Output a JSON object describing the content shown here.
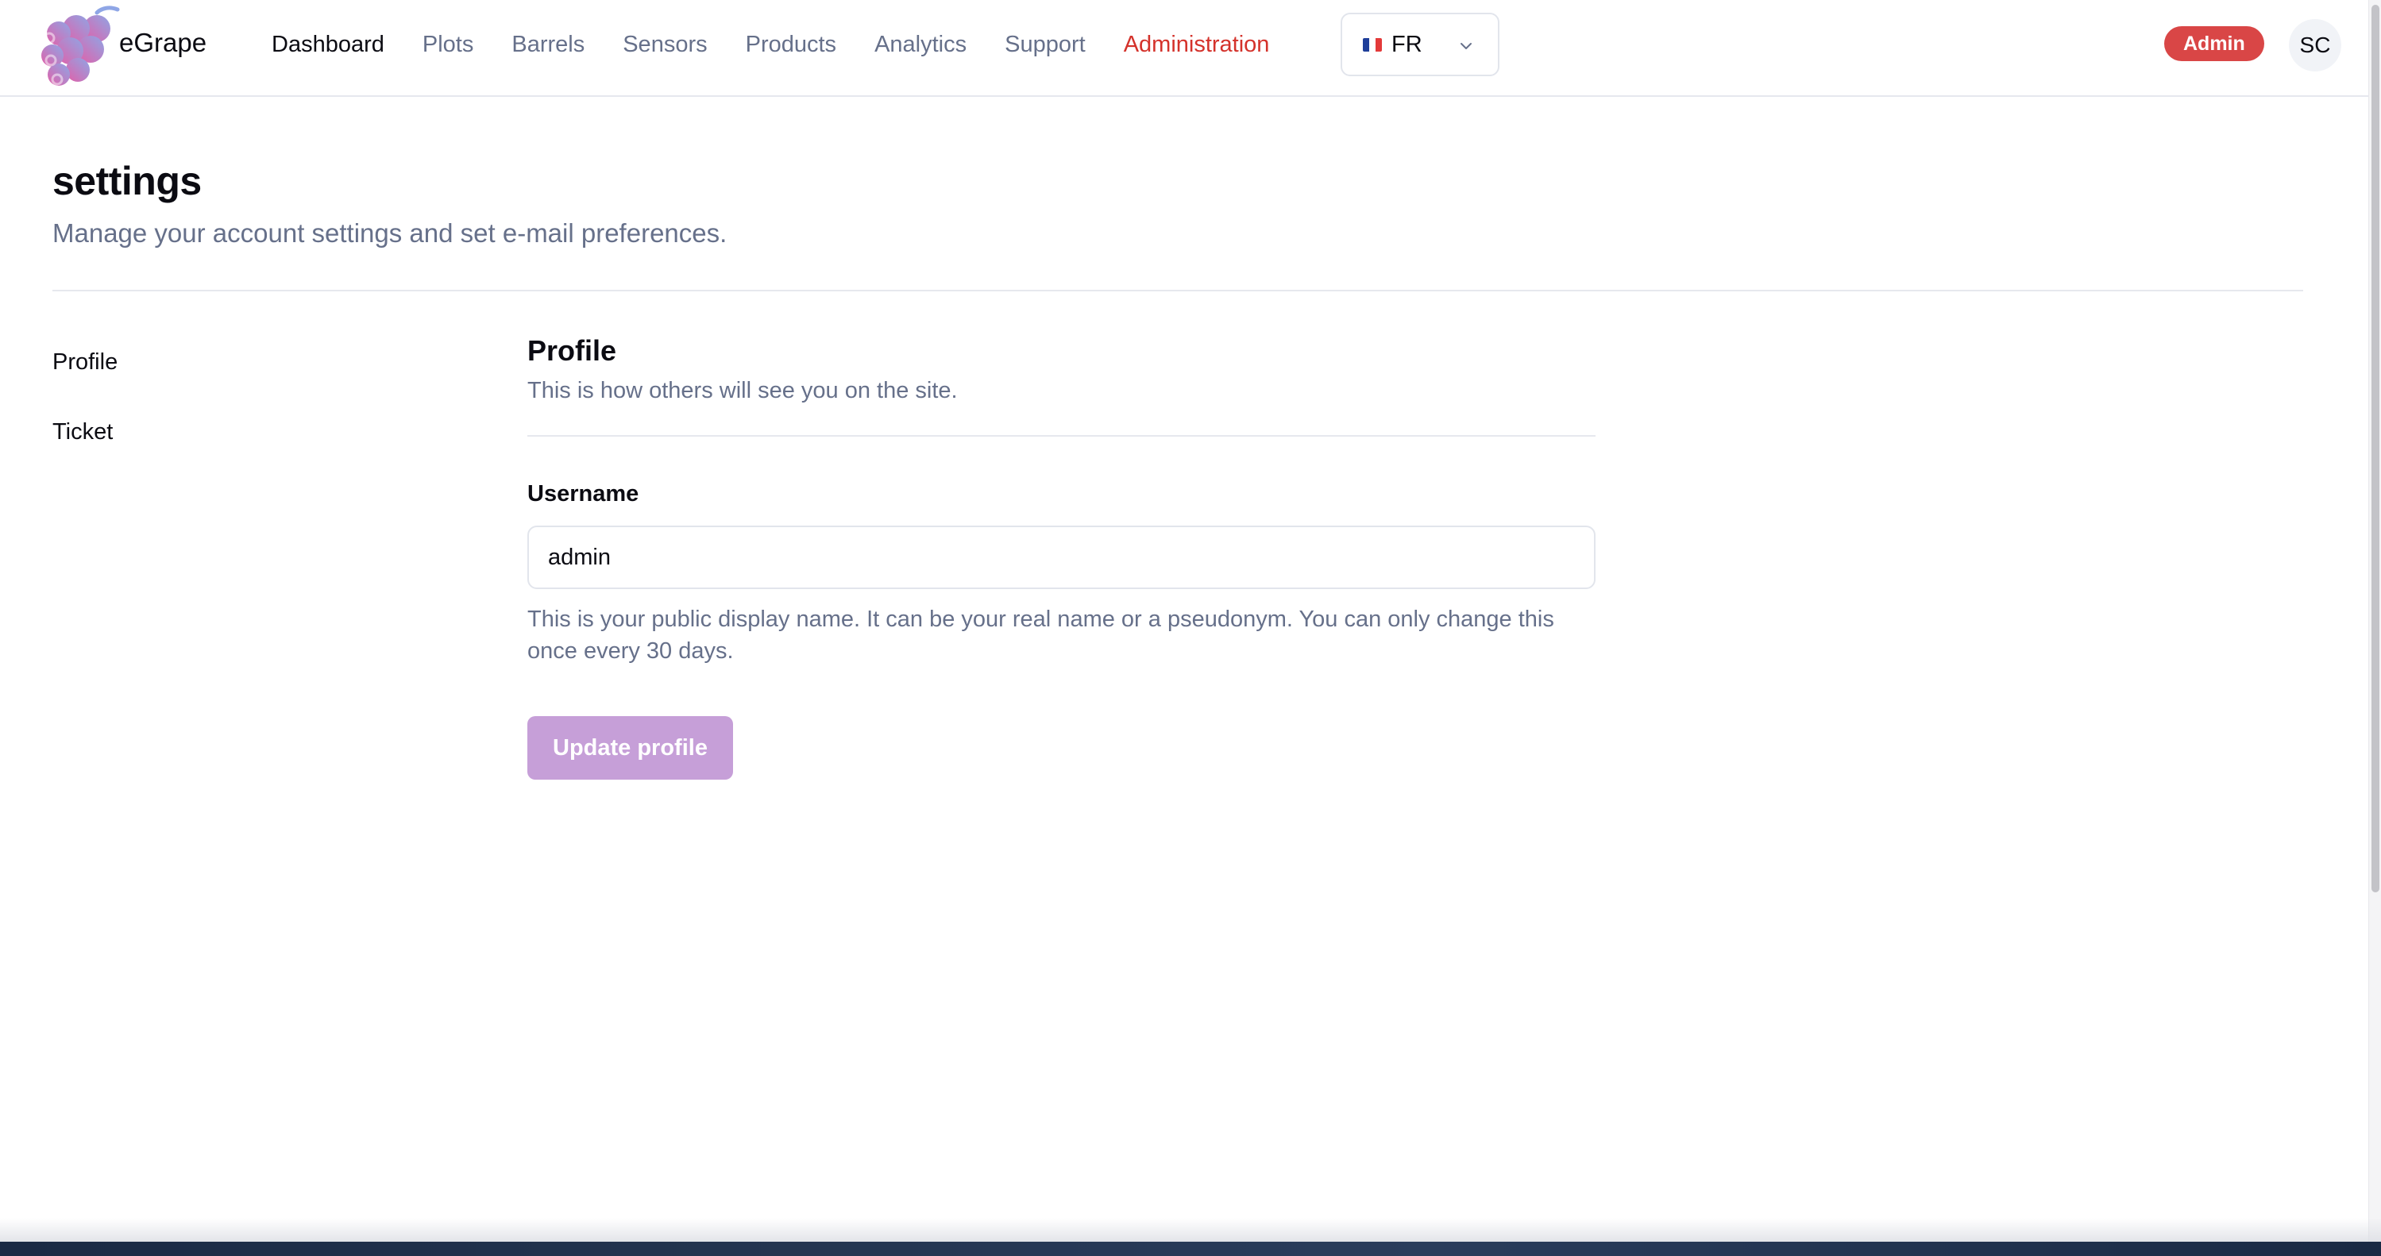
{
  "brand": {
    "name": "eGrape",
    "logo_colors": [
      "#c07ad6",
      "#8fa6e6",
      "#e35fa8",
      "#b9a0e8"
    ]
  },
  "nav": {
    "items": [
      {
        "label": "Dashboard",
        "state": "active"
      },
      {
        "label": "Plots",
        "state": "normal"
      },
      {
        "label": "Barrels",
        "state": "normal"
      },
      {
        "label": "Sensors",
        "state": "normal"
      },
      {
        "label": "Products",
        "state": "normal"
      },
      {
        "label": "Analytics",
        "state": "normal"
      },
      {
        "label": "Support",
        "state": "normal"
      },
      {
        "label": "Administration",
        "state": "admin"
      }
    ],
    "admin_color": "#d4322b"
  },
  "language": {
    "selected": "FR",
    "flag_colors": [
      "#1f3f99",
      "#ffffff",
      "#e33a3a"
    ]
  },
  "user": {
    "role_badge": "Admin",
    "role_badge_color": "#d94646",
    "initials": "SC"
  },
  "page": {
    "title": "settings",
    "subtitle": "Manage your account settings and set e-mail preferences."
  },
  "side_nav": {
    "items": [
      {
        "label": "Profile"
      },
      {
        "label": "Ticket"
      }
    ]
  },
  "profile": {
    "title": "Profile",
    "description": "This is how others will see you on the site.",
    "username_label": "Username",
    "username_value": "admin",
    "username_help": "This is your public display name. It can be your real name or a pseudonym. You can only change this once every 30 days.",
    "submit_label": "Update profile",
    "submit_color": "#c69fd8"
  }
}
